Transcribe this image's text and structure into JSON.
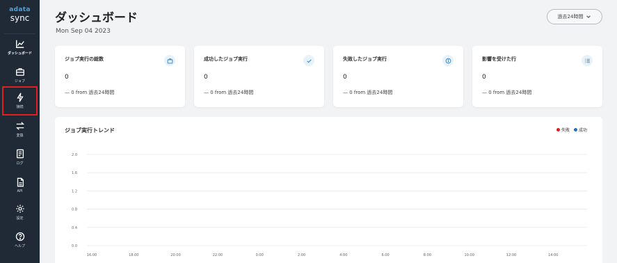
{
  "logo": {
    "line1": "adata",
    "line2": "sync"
  },
  "sidebar": {
    "items": [
      {
        "key": "dashboard",
        "label": "ダッシュボード",
        "icon": "chart-line-icon"
      },
      {
        "key": "jobs",
        "label": "ジョブ",
        "icon": "briefcase-icon"
      },
      {
        "key": "connections",
        "label": "接続",
        "icon": "lightning-icon"
      },
      {
        "key": "transform",
        "label": "変換",
        "icon": "arrows-swap-icon"
      },
      {
        "key": "logs",
        "label": "ログ",
        "icon": "log-icon"
      },
      {
        "key": "api",
        "label": "API",
        "icon": "document-icon"
      },
      {
        "key": "settings",
        "label": "設定",
        "icon": "gear-icon"
      },
      {
        "key": "help",
        "label": "ヘルプ",
        "icon": "help-icon"
      }
    ]
  },
  "header": {
    "title": "ダッシュボード",
    "date": "Mon Sep 04 2023",
    "period_label": "過去24時間"
  },
  "cards": [
    {
      "title": "ジョブ実行の総数",
      "value": "0",
      "sub": "— 0 from 過去24時間",
      "icon": "briefcase-icon"
    },
    {
      "title": "成功したジョブ実行",
      "value": "0",
      "sub": "— 0 from 過去24時間",
      "icon": "check-icon"
    },
    {
      "title": "失敗したジョブ実行",
      "value": "0",
      "sub": "— 0 from 過去24時間",
      "icon": "info-icon"
    },
    {
      "title": "影響を受けた行",
      "value": "0",
      "sub": "— 0 from 過去24時間",
      "icon": "list-icon"
    }
  ],
  "chart": {
    "title": "ジョブ実行トレンド",
    "legend": [
      {
        "name": "失敗",
        "color": "#e02020"
      },
      {
        "name": "成功",
        "color": "#1f6fc5"
      }
    ]
  },
  "chart_data": {
    "type": "line",
    "title": "ジョブ実行トレンド",
    "xlabel": "",
    "ylabel": "",
    "x": [
      "16:00",
      "18:00",
      "20:00",
      "22:00",
      "0:00",
      "2:00",
      "4:00",
      "6:00",
      "8:00",
      "10:00",
      "12:00",
      "14:00"
    ],
    "yticks": [
      "0.0",
      "0.4",
      "0.8",
      "1.2",
      "1.6",
      "2.0"
    ],
    "ylim": [
      0,
      2.0
    ],
    "series": [
      {
        "name": "失敗",
        "values": [
          0,
          0,
          0,
          0,
          0,
          0,
          0,
          0,
          0,
          0,
          0,
          0
        ]
      },
      {
        "name": "成功",
        "values": [
          0,
          0,
          0,
          0,
          0,
          0,
          0,
          0,
          0,
          0,
          0,
          0
        ]
      }
    ],
    "grid": true,
    "legend_position": "top-right"
  }
}
